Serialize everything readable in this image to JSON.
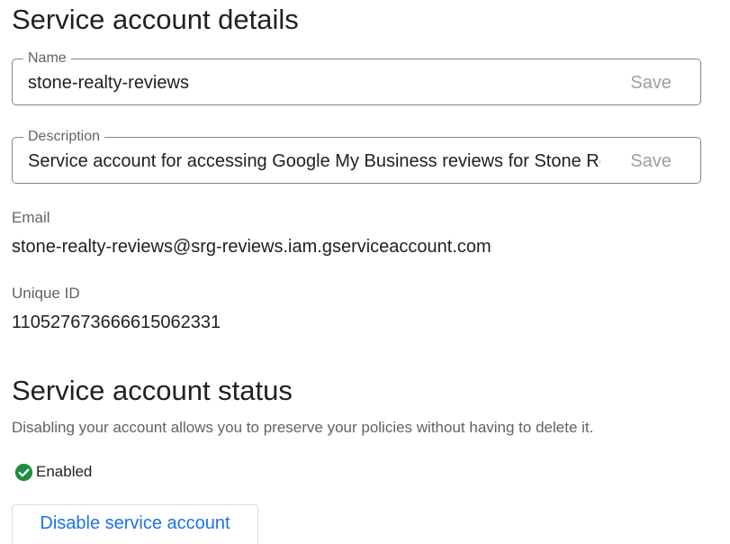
{
  "details": {
    "title": "Service account details",
    "name_field": {
      "label": "Name",
      "value": "stone-realty-reviews",
      "save_label": "Save"
    },
    "description_field": {
      "label": "Description",
      "value": "Service account for accessing Google My Business reviews for Stone Realty Group",
      "save_label": "Save"
    },
    "email": {
      "label": "Email",
      "value": "stone-realty-reviews@srg-reviews.iam.gserviceaccount.com"
    },
    "unique_id": {
      "label": "Unique ID",
      "value": "110527673666615062331"
    }
  },
  "status": {
    "title": "Service account status",
    "description": "Disabling your account allows you to preserve your policies without having to delete it.",
    "state_icon": "check-circle-icon",
    "state_color": "#1e8e3e",
    "state_label": "Enabled",
    "disable_button_label": "Disable service account"
  }
}
